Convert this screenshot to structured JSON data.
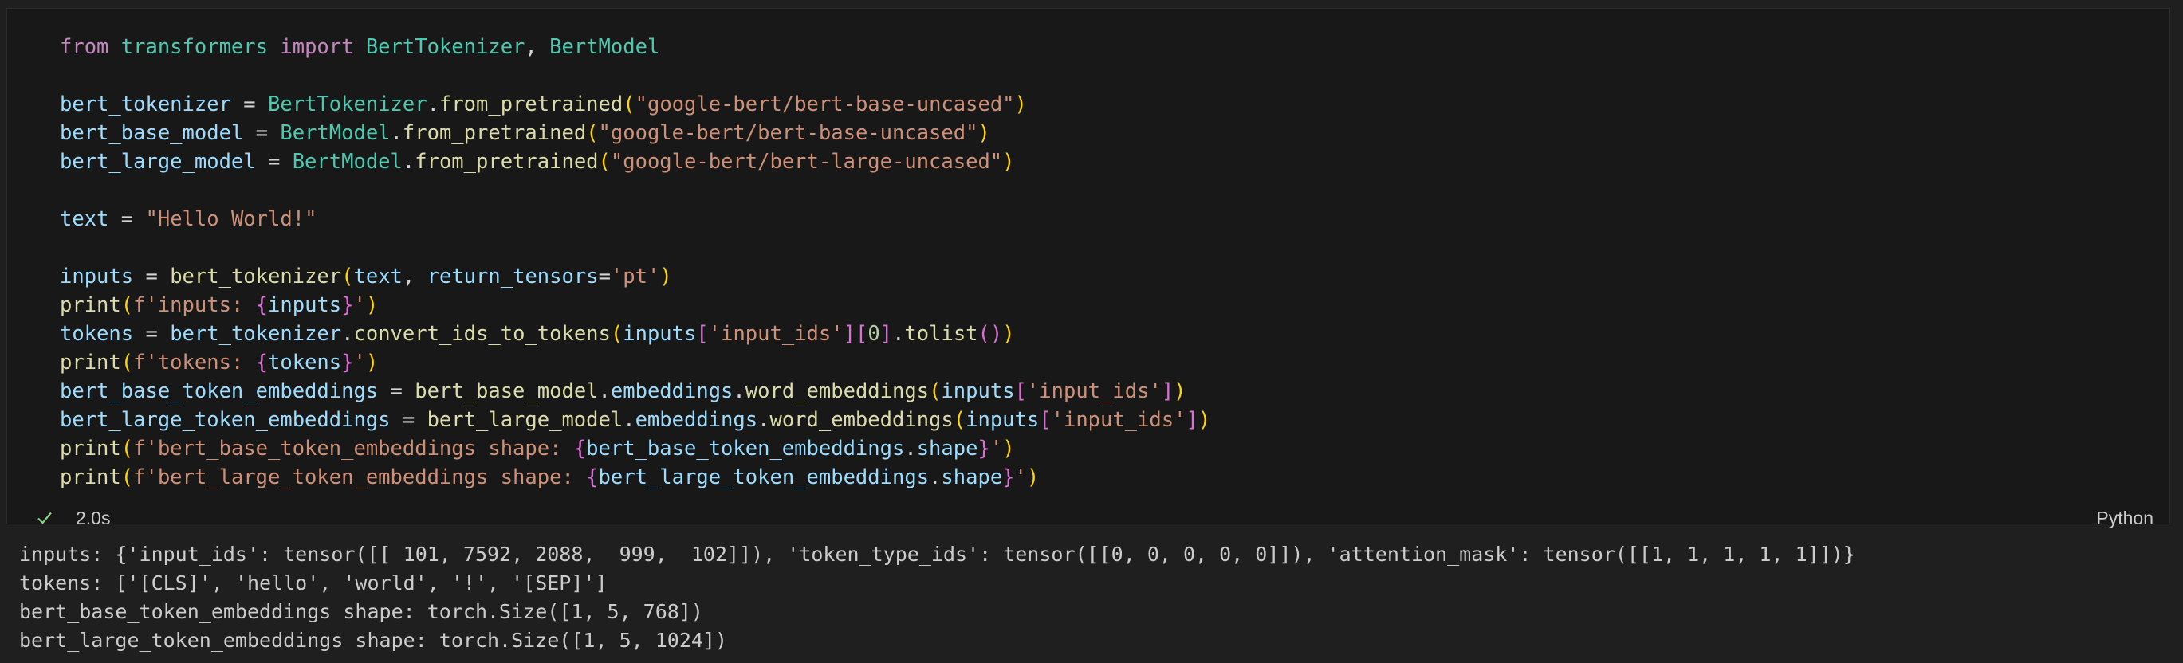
{
  "cell": {
    "code_lines": [
      [
        {
          "t": "from ",
          "c": "kw"
        },
        {
          "t": "transformers ",
          "c": "mod"
        },
        {
          "t": "import ",
          "c": "kw"
        },
        {
          "t": "BertTokenizer",
          "c": "cls"
        },
        {
          "t": ", ",
          "c": "op"
        },
        {
          "t": "BertModel",
          "c": "cls"
        }
      ],
      [],
      [
        {
          "t": "bert_tokenizer",
          "c": "var"
        },
        {
          "t": " = ",
          "c": "op"
        },
        {
          "t": "BertTokenizer",
          "c": "cls"
        },
        {
          "t": ".",
          "c": "op"
        },
        {
          "t": "from_pretrained",
          "c": "fn"
        },
        {
          "t": "(",
          "c": "p1"
        },
        {
          "t": "\"google-bert/bert-base-uncased\"",
          "c": "str"
        },
        {
          "t": ")",
          "c": "p1"
        }
      ],
      [
        {
          "t": "bert_base_model",
          "c": "var"
        },
        {
          "t": " = ",
          "c": "op"
        },
        {
          "t": "BertModel",
          "c": "cls"
        },
        {
          "t": ".",
          "c": "op"
        },
        {
          "t": "from_pretrained",
          "c": "fn"
        },
        {
          "t": "(",
          "c": "p1"
        },
        {
          "t": "\"google-bert/bert-base-uncased\"",
          "c": "str"
        },
        {
          "t": ")",
          "c": "p1"
        }
      ],
      [
        {
          "t": "bert_large_model",
          "c": "var"
        },
        {
          "t": " = ",
          "c": "op"
        },
        {
          "t": "BertModel",
          "c": "cls"
        },
        {
          "t": ".",
          "c": "op"
        },
        {
          "t": "from_pretrained",
          "c": "fn"
        },
        {
          "t": "(",
          "c": "p1"
        },
        {
          "t": "\"google-bert/bert-large-uncased\"",
          "c": "str"
        },
        {
          "t": ")",
          "c": "p1"
        }
      ],
      [],
      [
        {
          "t": "text",
          "c": "var"
        },
        {
          "t": " = ",
          "c": "op"
        },
        {
          "t": "\"Hello World!\"",
          "c": "str"
        }
      ],
      [],
      [
        {
          "t": "inputs",
          "c": "var"
        },
        {
          "t": " = ",
          "c": "op"
        },
        {
          "t": "bert_tokenizer",
          "c": "fn"
        },
        {
          "t": "(",
          "c": "p1"
        },
        {
          "t": "text",
          "c": "var"
        },
        {
          "t": ", ",
          "c": "op"
        },
        {
          "t": "return_tensors",
          "c": "var"
        },
        {
          "t": "=",
          "c": "op"
        },
        {
          "t": "'pt'",
          "c": "str"
        },
        {
          "t": ")",
          "c": "p1"
        }
      ],
      [
        {
          "t": "print",
          "c": "fn"
        },
        {
          "t": "(",
          "c": "p1"
        },
        {
          "t": "f'inputs: ",
          "c": "str"
        },
        {
          "t": "{",
          "c": "p2"
        },
        {
          "t": "inputs",
          "c": "var"
        },
        {
          "t": "}",
          "c": "p2"
        },
        {
          "t": "'",
          "c": "str"
        },
        {
          "t": ")",
          "c": "p1"
        }
      ],
      [
        {
          "t": "tokens",
          "c": "var"
        },
        {
          "t": " = ",
          "c": "op"
        },
        {
          "t": "bert_tokenizer",
          "c": "var"
        },
        {
          "t": ".",
          "c": "op"
        },
        {
          "t": "convert_ids_to_tokens",
          "c": "fn"
        },
        {
          "t": "(",
          "c": "p1"
        },
        {
          "t": "inputs",
          "c": "var"
        },
        {
          "t": "[",
          "c": "p2"
        },
        {
          "t": "'input_ids'",
          "c": "str"
        },
        {
          "t": "]",
          "c": "p2"
        },
        {
          "t": "[",
          "c": "p2"
        },
        {
          "t": "0",
          "c": "num"
        },
        {
          "t": "]",
          "c": "p2"
        },
        {
          "t": ".",
          "c": "op"
        },
        {
          "t": "tolist",
          "c": "fn"
        },
        {
          "t": "(",
          "c": "p2"
        },
        {
          "t": ")",
          "c": "p2"
        },
        {
          "t": ")",
          "c": "p1"
        }
      ],
      [
        {
          "t": "print",
          "c": "fn"
        },
        {
          "t": "(",
          "c": "p1"
        },
        {
          "t": "f'tokens: ",
          "c": "str"
        },
        {
          "t": "{",
          "c": "p2"
        },
        {
          "t": "tokens",
          "c": "var"
        },
        {
          "t": "}",
          "c": "p2"
        },
        {
          "t": "'",
          "c": "str"
        },
        {
          "t": ")",
          "c": "p1"
        }
      ],
      [
        {
          "t": "bert_base_token_embeddings",
          "c": "var"
        },
        {
          "t": " = ",
          "c": "op"
        },
        {
          "t": "bert_base_model",
          "c": "fn"
        },
        {
          "t": ".",
          "c": "op"
        },
        {
          "t": "embeddings",
          "c": "var"
        },
        {
          "t": ".",
          "c": "op"
        },
        {
          "t": "word_embeddings",
          "c": "fn"
        },
        {
          "t": "(",
          "c": "p1"
        },
        {
          "t": "inputs",
          "c": "var"
        },
        {
          "t": "[",
          "c": "p2"
        },
        {
          "t": "'input_ids'",
          "c": "str"
        },
        {
          "t": "]",
          "c": "p2"
        },
        {
          "t": ")",
          "c": "p1"
        }
      ],
      [
        {
          "t": "bert_large_token_embeddings",
          "c": "var"
        },
        {
          "t": " = ",
          "c": "op"
        },
        {
          "t": "bert_large_model",
          "c": "fn"
        },
        {
          "t": ".",
          "c": "op"
        },
        {
          "t": "embeddings",
          "c": "var"
        },
        {
          "t": ".",
          "c": "op"
        },
        {
          "t": "word_embeddings",
          "c": "fn"
        },
        {
          "t": "(",
          "c": "p1"
        },
        {
          "t": "inputs",
          "c": "var"
        },
        {
          "t": "[",
          "c": "p2"
        },
        {
          "t": "'input_ids'",
          "c": "str"
        },
        {
          "t": "]",
          "c": "p2"
        },
        {
          "t": ")",
          "c": "p1"
        }
      ],
      [
        {
          "t": "print",
          "c": "fn"
        },
        {
          "t": "(",
          "c": "p1"
        },
        {
          "t": "f'bert_base_token_embeddings shape: ",
          "c": "str"
        },
        {
          "t": "{",
          "c": "p2"
        },
        {
          "t": "bert_base_token_embeddings",
          "c": "var"
        },
        {
          "t": ".",
          "c": "op"
        },
        {
          "t": "shape",
          "c": "var"
        },
        {
          "t": "}",
          "c": "p2"
        },
        {
          "t": "'",
          "c": "str"
        },
        {
          "t": ")",
          "c": "p1"
        }
      ],
      [
        {
          "t": "print",
          "c": "fn"
        },
        {
          "t": "(",
          "c": "p1"
        },
        {
          "t": "f'bert_large_token_embeddings shape: ",
          "c": "str"
        },
        {
          "t": "{",
          "c": "p2"
        },
        {
          "t": "bert_large_token_embeddings",
          "c": "var"
        },
        {
          "t": ".",
          "c": "op"
        },
        {
          "t": "shape",
          "c": "var"
        },
        {
          "t": "}",
          "c": "p2"
        },
        {
          "t": "'",
          "c": "str"
        },
        {
          "t": ")",
          "c": "p1"
        }
      ]
    ],
    "status_icon": "check-icon",
    "exec_time": "2.0s",
    "language": "Python"
  },
  "output": {
    "lines": [
      "inputs: {'input_ids': tensor([[ 101, 7592, 2088,  999,  102]]), 'token_type_ids': tensor([[0, 0, 0, 0, 0]]), 'attention_mask': tensor([[1, 1, 1, 1, 1]])}",
      "tokens: ['[CLS]', 'hello', 'world', '!', '[SEP]']",
      "bert_base_token_embeddings shape: torch.Size([1, 5, 768])",
      "bert_large_token_embeddings shape: torch.Size([1, 5, 1024])"
    ]
  },
  "colors": {
    "background": "#1f1f1f",
    "cell_background": "#181818",
    "success": "#89d185"
  }
}
